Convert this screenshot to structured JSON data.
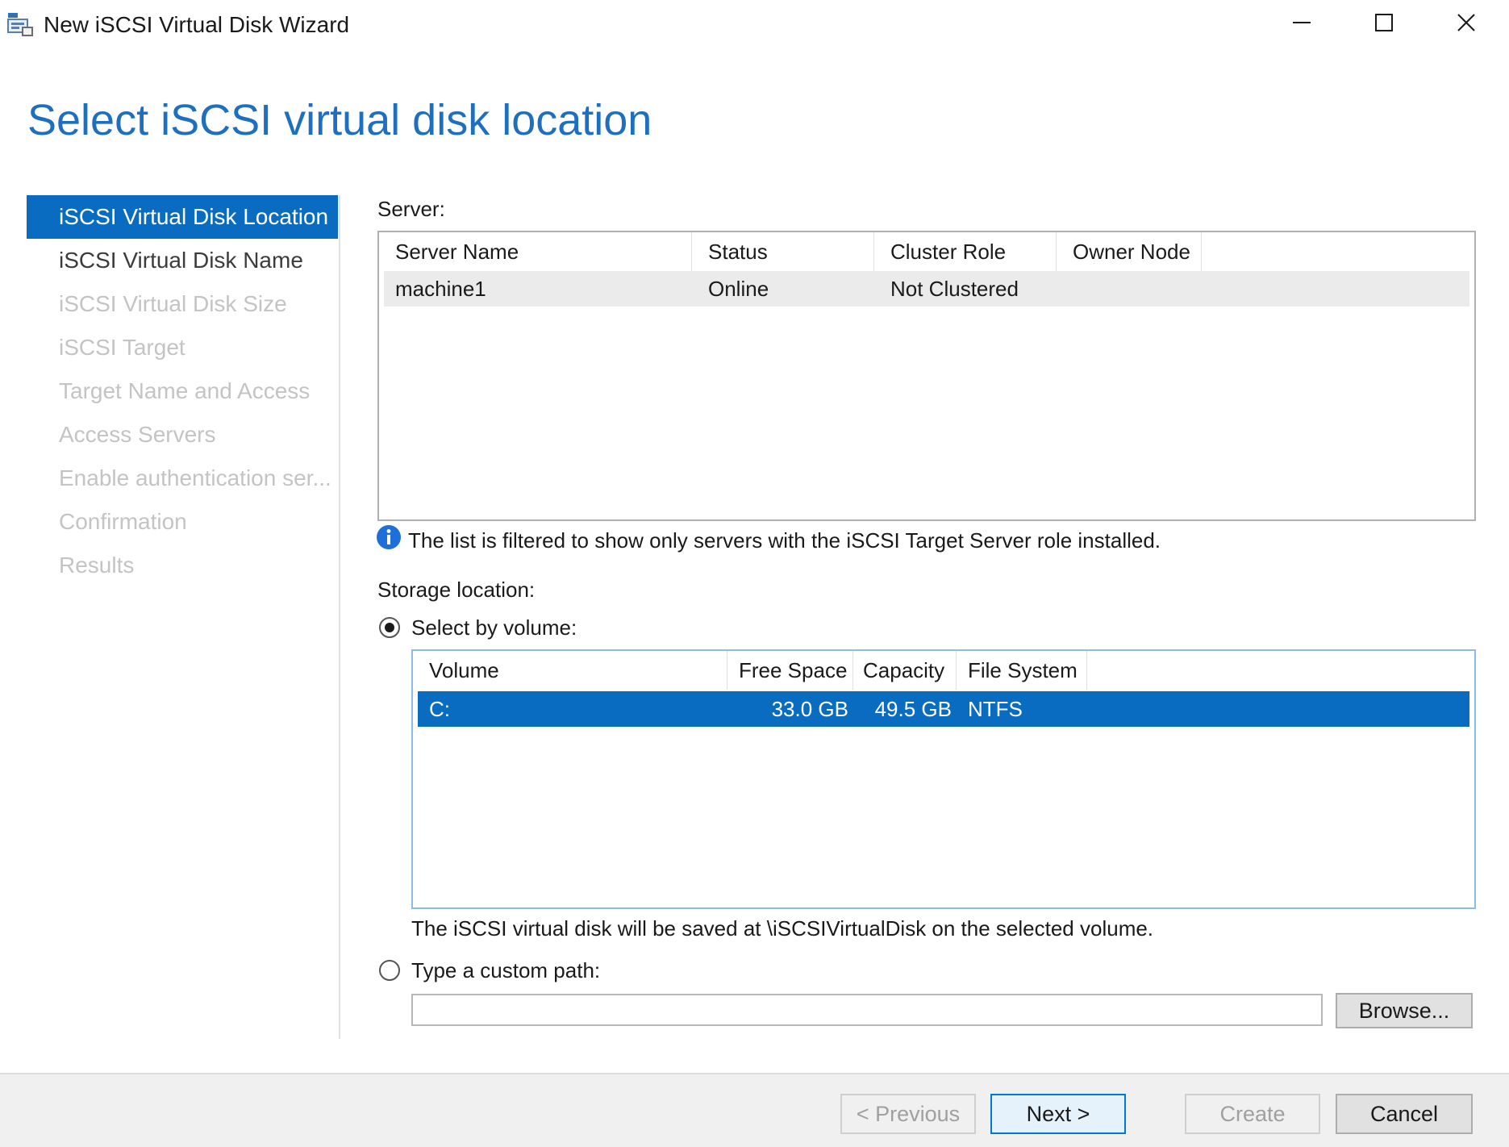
{
  "window": {
    "title": "New iSCSI Virtual Disk Wizard",
    "icon": "iscsi-wizard-icon",
    "controls": [
      "minimize-icon",
      "maximize-icon",
      "close-icon"
    ]
  },
  "page": {
    "heading": "Select iSCSI virtual disk location"
  },
  "sidebar": {
    "items": [
      {
        "label": "iSCSI Virtual Disk Location",
        "state": "active"
      },
      {
        "label": "iSCSI Virtual Disk Name",
        "state": "enabled"
      },
      {
        "label": "iSCSI Virtual Disk Size",
        "state": "disabled"
      },
      {
        "label": "iSCSI Target",
        "state": "disabled"
      },
      {
        "label": "Target Name and Access",
        "state": "disabled"
      },
      {
        "label": "Access Servers",
        "state": "disabled"
      },
      {
        "label": "Enable authentication ser...",
        "state": "disabled"
      },
      {
        "label": "Confirmation",
        "state": "disabled"
      },
      {
        "label": "Results",
        "state": "disabled"
      }
    ]
  },
  "server": {
    "label": "Server:",
    "columns": [
      "Server Name",
      "Status",
      "Cluster Role",
      "Owner Node"
    ],
    "rows": [
      {
        "server_name": "machine1",
        "status": "Online",
        "cluster_role": "Not Clustered",
        "owner_node": ""
      }
    ]
  },
  "info": {
    "icon": "info-icon",
    "text": "The list is filtered to show only servers with the iSCSI Target Server role installed."
  },
  "storage": {
    "label": "Storage location:",
    "by_volume": {
      "label": "Select by volume:",
      "selected": true
    },
    "volume_columns": [
      "Volume",
      "Free Space",
      "Capacity",
      "File System"
    ],
    "volumes": [
      {
        "volume": "C:",
        "free_space": "33.0 GB",
        "capacity": "49.5 GB",
        "file_system": "NTFS",
        "selected": true
      }
    ],
    "save_note": "The iSCSI virtual disk will be saved at \\iSCSIVirtualDisk on the selected volume.",
    "custom_path": {
      "label": "Type a custom path:",
      "selected": false,
      "value": "",
      "browse_label": "Browse..."
    }
  },
  "footer": {
    "previous_label": "< Previous",
    "next_label": "Next >",
    "create_label": "Create",
    "cancel_label": "Cancel"
  },
  "colors": {
    "accent": "#0a6cc0",
    "heading": "#1e6fbf",
    "disabled_text": "#c4c4c4"
  }
}
